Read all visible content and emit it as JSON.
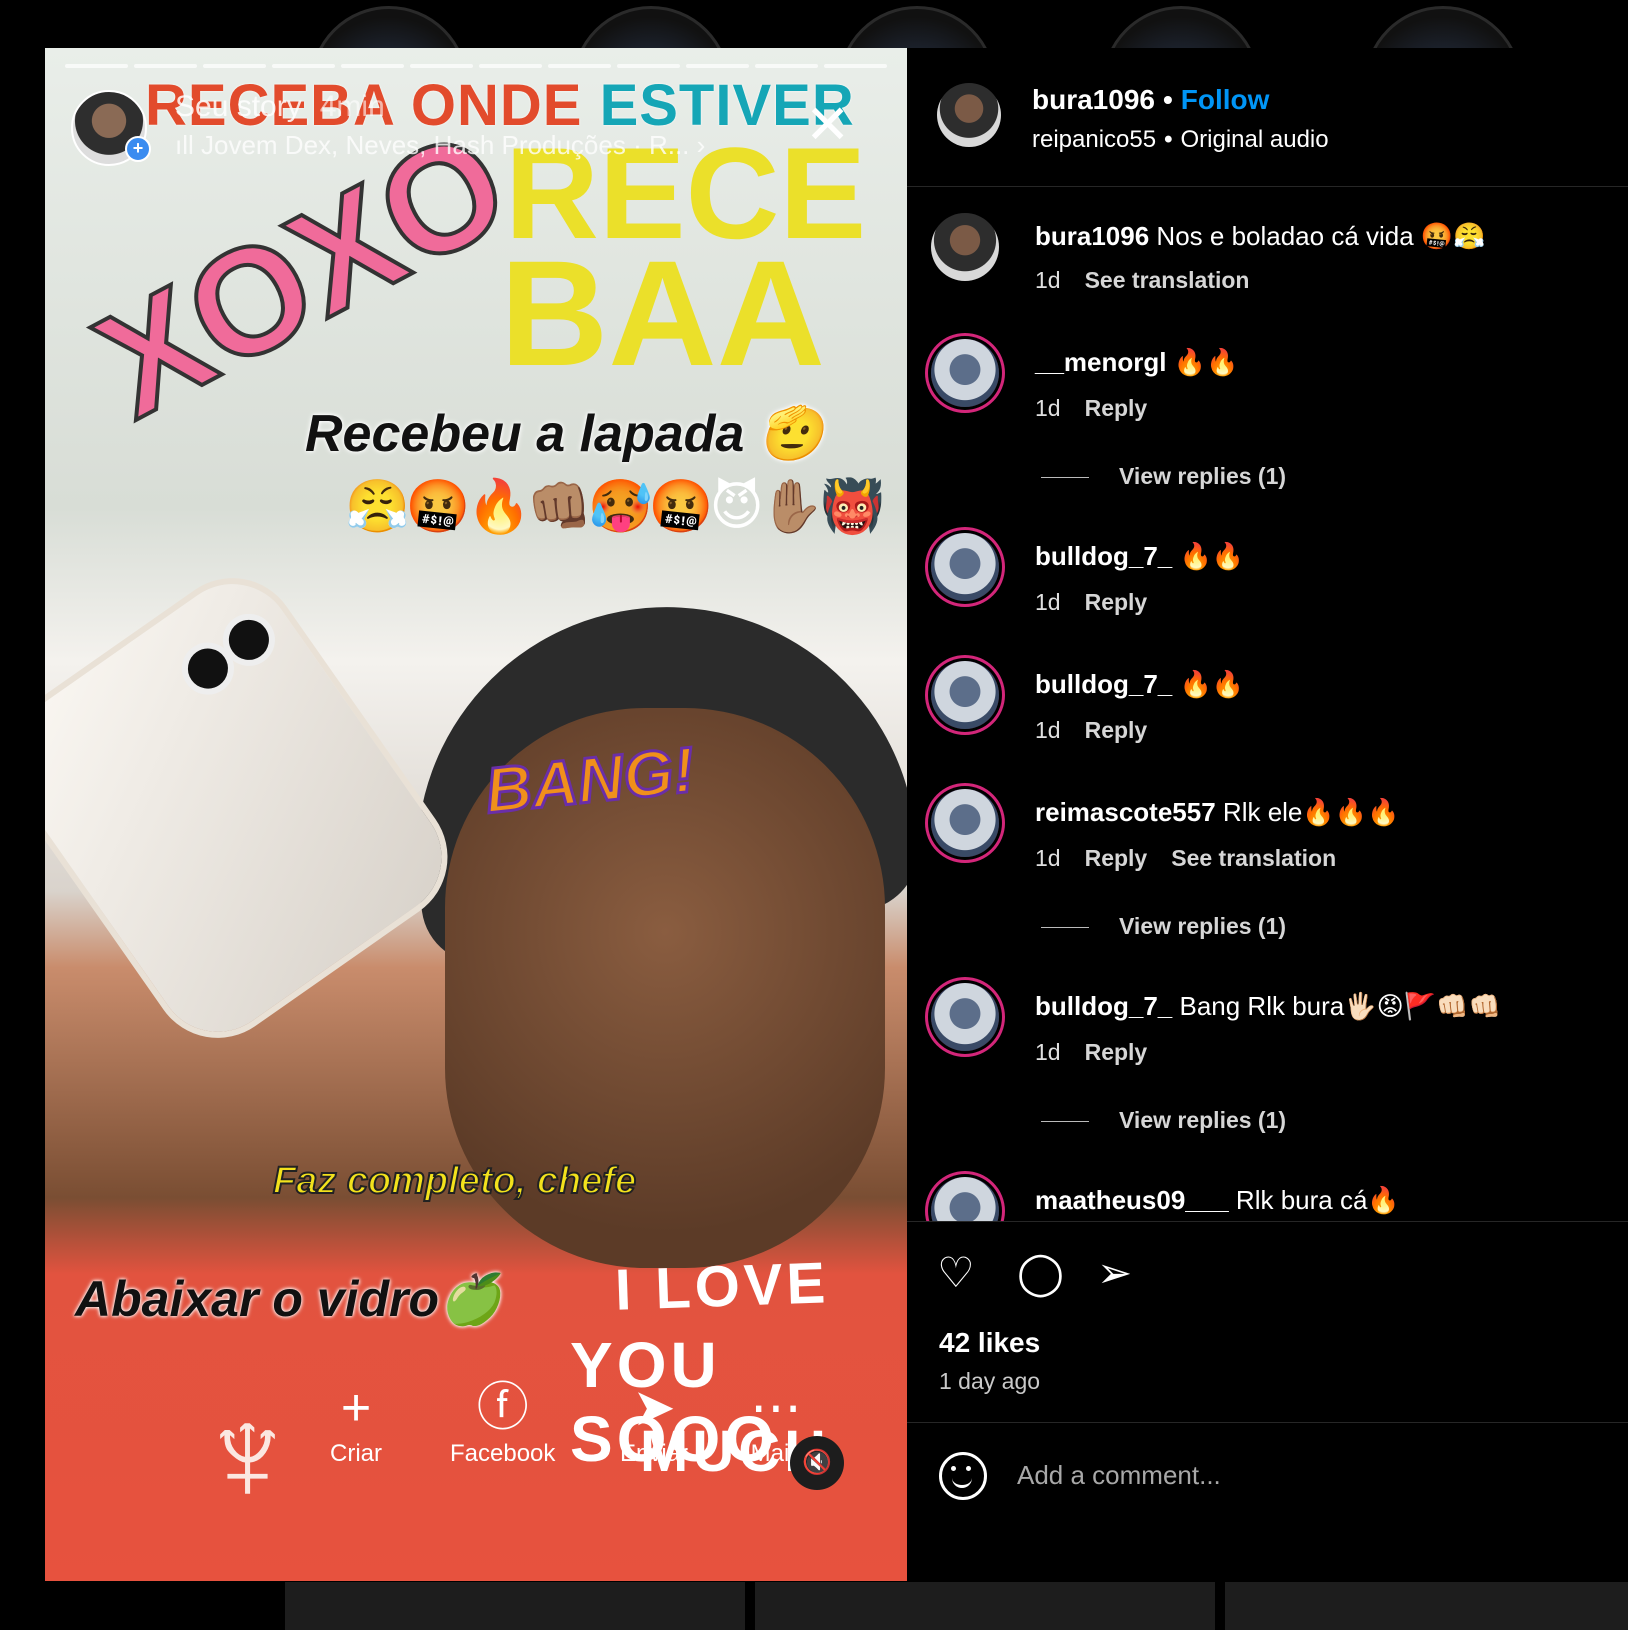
{
  "story": {
    "banner_part1": "RECEBA ONDE ",
    "banner_part2": "ESTIVER",
    "user": "Seu story",
    "time": "4min",
    "music": "Jovem Dex, Neves, Hash Produções · R...",
    "rece": "RECE",
    "baa": "BAA",
    "xoxo": "XOXO",
    "recebeu": "Recebeu a lapada 🫡",
    "emojis": "😤🤬🔥👊🏽🥵🤬😈✋🏽👹",
    "bang": "BANG!",
    "faz": "Faz completo, chefe",
    "abaixar": "Abaixar o vidro🍏",
    "shirt_line1": "I LOVE",
    "shirt_line2": "YOU SOOO",
    "shirt_line3": "MUCH",
    "actions": [
      {
        "icon": "+",
        "label": "Criar"
      },
      {
        "icon": "ⓕ",
        "label": "Facebook"
      },
      {
        "icon": "➤",
        "label": "Enviar"
      },
      {
        "icon": "⋯",
        "label": "Mais"
      }
    ]
  },
  "post": {
    "username": "bura1096",
    "follow_label": "Follow",
    "audio_user": "reipanico55",
    "audio_label": "Original audio",
    "likes": "42 likes",
    "time_ago": "1 day ago",
    "comment_placeholder": "Add a comment..."
  },
  "comments": [
    {
      "user": "bura1096",
      "text": "Nos e boladao cá vida 🤬😤",
      "age": "1d",
      "reply": "",
      "translate": "See translation",
      "replies": ""
    },
    {
      "user": "__menorgl",
      "text": "🔥🔥",
      "age": "1d",
      "reply": "Reply",
      "translate": "",
      "replies": "View replies (1)"
    },
    {
      "user": "bulldog_7_",
      "text": "🔥🔥",
      "age": "1d",
      "reply": "Reply",
      "translate": "",
      "replies": ""
    },
    {
      "user": "bulldog_7_",
      "text": "🔥🔥",
      "age": "1d",
      "reply": "Reply",
      "translate": "",
      "replies": ""
    },
    {
      "user": "reimascote557",
      "text": "Rlk ele🔥🔥🔥",
      "age": "1d",
      "reply": "Reply",
      "translate": "See translation",
      "replies": "View replies (1)"
    },
    {
      "user": "bulldog_7_",
      "text": "Bang Rlk bura🖐🏻😡🚩👊🏻👊🏻",
      "age": "1d",
      "reply": "Reply",
      "translate": "",
      "replies": "View replies (1)"
    },
    {
      "user": "maatheus09___",
      "text": "Rlk bura cá🔥",
      "age": "",
      "reply": "",
      "translate": "",
      "replies": ""
    }
  ]
}
